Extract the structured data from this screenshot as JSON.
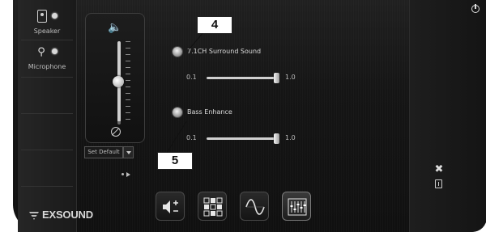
{
  "devices": [
    {
      "name": "Speaker"
    },
    {
      "name": "Microphone"
    }
  ],
  "brand": {
    "name": "EXSOUND"
  },
  "volume": {
    "level": 0.5
  },
  "default_control": {
    "label": "Set Default"
  },
  "effects": [
    {
      "label": "7.1CH Surround Sound",
      "min": "0.1",
      "max": "1.0",
      "value": 1.0
    },
    {
      "label": "Bass Enhance",
      "min": "0.1",
      "max": "1.0",
      "value": 1.0
    }
  ],
  "callouts": [
    {
      "number": "4"
    },
    {
      "number": "5"
    }
  ],
  "icons": {
    "speaker_device": "speaker-icon",
    "microphone_device": "microphone-icon",
    "volume": "volume-icon",
    "mute": "mute-icon",
    "power": "power-icon",
    "tools": "tools-icon",
    "info": "info-icon",
    "tabs": [
      "speaker-settings-icon",
      "environment-icon",
      "equalizer-wave-icon",
      "mixer-icon"
    ]
  }
}
